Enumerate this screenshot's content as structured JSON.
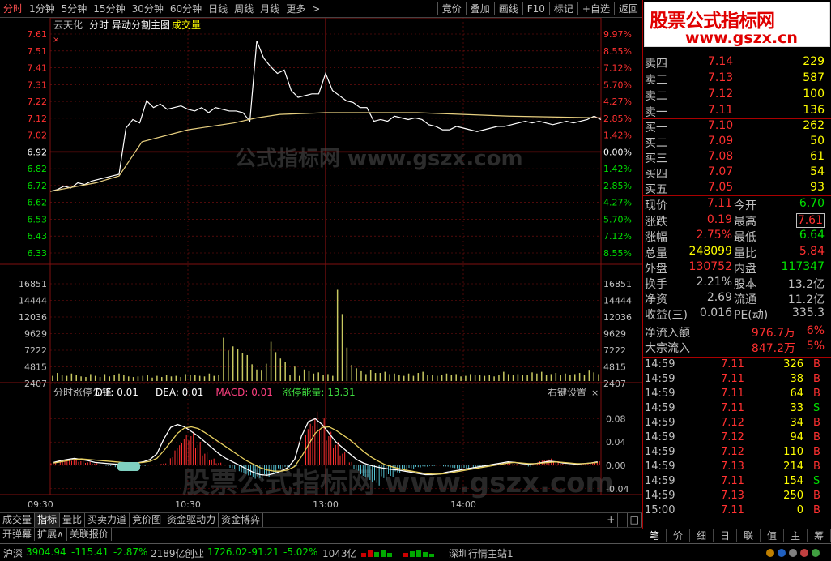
{
  "toolbar": {
    "periods": [
      "分时",
      "1分钟",
      "5分钟",
      "15分钟",
      "30分钟",
      "60分钟",
      "日线",
      "周线",
      "月线",
      "更多"
    ],
    "more_arrow": ">",
    "right_buttons": [
      "竞价",
      "叠加",
      "画线",
      "F10",
      "标记",
      "+自选",
      "返回"
    ]
  },
  "chart_header": {
    "stock": "云天化",
    "mode": "分时",
    "overlay": "异动分割主图",
    "volume_label": "成交量",
    "close_mark": "×"
  },
  "indicator_header": {
    "name": "分时涨停先锋",
    "dif": "DIF: 0.01",
    "dea": "DEA: 0.01",
    "macd": "MACD: 0.01",
    "energy": "涨停能量: 13.31",
    "settings": "右键设置",
    "close": "×"
  },
  "watermark_left": "公式指标网 www.gszx.com",
  "watermark_right": "股票公式指标网 www.gszx.com",
  "colors": {
    "up": "#ff3030",
    "down": "#00e000",
    "flat": "#c0c0c0",
    "price_line": "#ffffff",
    "avg_line": "#e8d080",
    "volume": "#c8c860",
    "grid": "#801010",
    "yellow": "#ffff00",
    "macd_pos": "#ff3030",
    "macd_neg": "#54c0d0"
  },
  "chart_data": [
    {
      "type": "line",
      "title": "分时",
      "y_left_ticks": [
        "7.61",
        "7.51",
        "7.41",
        "7.31",
        "7.22",
        "7.12",
        "7.02",
        "6.92",
        "6.82",
        "6.72",
        "6.62",
        "6.53",
        "6.43",
        "6.33"
      ],
      "y_right_ticks": [
        "9.97%",
        "8.55%",
        "7.12%",
        "5.70%",
        "4.27%",
        "2.85%",
        "1.42%",
        "0.00%",
        "1.42%",
        "2.85%",
        "4.27%",
        "5.70%",
        "7.12%",
        "8.55%"
      ],
      "x_ticks": [
        "09:30",
        "10:30",
        "13:00",
        "14:00"
      ],
      "ylim": [
        6.33,
        7.61
      ],
      "prev_close": 6.92,
      "series": [
        {
          "name": "价格",
          "x": [
            0,
            3,
            6,
            9,
            12,
            15,
            18,
            21,
            24,
            27,
            30,
            33,
            36,
            39,
            42,
            45,
            48,
            51,
            54,
            57,
            60,
            63,
            66,
            69,
            72,
            75,
            78,
            81,
            84,
            87,
            90,
            93,
            96,
            99,
            102,
            105,
            108,
            111,
            114,
            117,
            120,
            123,
            126,
            129,
            132,
            135,
            138,
            141,
            144,
            147,
            150,
            153,
            156,
            159,
            162,
            165,
            168,
            171,
            174,
            177,
            180,
            183,
            186,
            189,
            192,
            195,
            198,
            201,
            204,
            207,
            210,
            213,
            216,
            219,
            222,
            225,
            228,
            231,
            234,
            237,
            240
          ],
          "values": [
            6.69,
            6.7,
            6.72,
            6.71,
            6.74,
            6.73,
            6.75,
            6.76,
            6.77,
            6.78,
            6.79,
            7.06,
            7.11,
            7.09,
            7.22,
            7.18,
            7.2,
            7.17,
            7.18,
            7.19,
            7.17,
            7.16,
            7.18,
            7.15,
            7.18,
            7.17,
            7.16,
            7.16,
            7.15,
            7.1,
            7.57,
            7.47,
            7.42,
            7.38,
            7.4,
            7.28,
            7.24,
            7.25,
            7.26,
            7.26,
            7.38,
            7.28,
            7.25,
            7.22,
            7.21,
            7.18,
            7.18,
            7.1,
            7.11,
            7.1,
            7.13,
            7.12,
            7.11,
            7.12,
            7.11,
            7.08,
            7.07,
            7.05,
            7.05,
            7.07,
            7.06,
            7.05,
            7.04,
            7.05,
            7.06,
            7.07,
            7.07,
            7.08,
            7.09,
            7.1,
            7.09,
            7.1,
            7.09,
            7.08,
            7.09,
            7.1,
            7.09,
            7.1,
            7.11,
            7.13,
            7.11
          ]
        },
        {
          "name": "均价",
          "x": [
            0,
            20,
            30,
            40,
            60,
            80,
            90,
            100,
            120,
            160,
            200,
            240
          ],
          "values": [
            6.69,
            6.74,
            6.78,
            6.98,
            7.05,
            7.09,
            7.12,
            7.14,
            7.15,
            7.15,
            7.13,
            7.12
          ]
        }
      ]
    },
    {
      "type": "bar",
      "title": "成交量",
      "y_ticks": [
        "16851",
        "14444",
        "12036",
        "9629",
        "7222",
        "4815",
        "2407"
      ],
      "ylim": [
        0,
        16851
      ],
      "volumes_by_bucket": [
        900,
        1400,
        1100,
        900,
        1300,
        1000,
        800,
        700,
        1200,
        900,
        700,
        1200,
        800,
        1000,
        1300,
        1100,
        800,
        700,
        800,
        900,
        1000,
        600,
        900,
        700,
        1000,
        800,
        900,
        700,
        1200,
        1100,
        1000,
        900,
        800,
        1300,
        900,
        1000,
        7500,
        5300,
        6000,
        5600,
        4800,
        4500,
        2900,
        2000,
        1800,
        3000,
        6800,
        5000,
        3900,
        3300,
        1100,
        2500,
        900,
        2000,
        1700,
        1300,
        1500,
        1100,
        1200,
        900,
        15800,
        11600,
        5800,
        2800,
        2200,
        1700,
        1200,
        1900,
        1400,
        1400,
        1600,
        1200,
        1300,
        1100,
        900,
        1300,
        900,
        1400,
        1600,
        1100,
        1000,
        900,
        1100,
        1300,
        1000,
        1200,
        800,
        900,
        1200,
        1000,
        1100,
        900,
        1000,
        800,
        1100,
        1600,
        1200,
        1000,
        1200,
        1000,
        1100,
        1500,
        1300,
        1600,
        1100,
        1200,
        1400,
        1100,
        1300,
        1100,
        1200,
        1400,
        1000,
        1800,
        1500,
        1200
      ]
    },
    {
      "type": "bar",
      "title": "分时涨停先锋",
      "y_ticks": [
        "0.08",
        "0.04",
        "0.00",
        "-0.04"
      ],
      "ylim": [
        -0.05,
        0.1
      ],
      "macd": [
        0.004,
        0.006,
        0.008,
        0.009,
        0.007,
        0.005,
        0.003,
        0.001,
        -0.001,
        -0.003,
        -0.004,
        -0.003,
        -0.002,
        -0.001,
        0.0,
        0.001,
        0.003,
        0.012,
        0.03,
        0.045,
        0.05,
        0.035,
        0.02,
        0.01,
        0.004,
        0.0,
        -0.005,
        -0.01,
        -0.015,
        -0.02,
        -0.022,
        -0.018,
        -0.012,
        -0.006,
        -0.003,
        -0.001,
        0.0,
        0.062,
        0.08,
        0.07,
        0.05,
        0.035,
        0.02,
        0.005,
        -0.008,
        -0.018,
        -0.025,
        -0.03,
        -0.022,
        -0.018,
        -0.012,
        -0.008,
        -0.005,
        -0.003,
        -0.002,
        -0.001,
        0.0,
        -0.002,
        -0.004,
        -0.006,
        -0.005,
        -0.004,
        -0.003,
        -0.002,
        0.002,
        0.004,
        0.003,
        0.002,
        0.0,
        -0.002,
        0.004,
        0.008,
        0.01,
        0.006,
        0.003,
        0.001,
        0.0,
        0.002,
        0.004,
        0.006
      ],
      "dif": [
        0.005,
        0.008,
        0.01,
        0.012,
        0.01,
        0.008,
        0.005,
        0.004,
        0.003,
        0.002,
        0.002,
        0.003,
        0.004,
        0.006,
        0.01,
        0.02,
        0.045,
        0.065,
        0.07,
        0.066,
        0.058,
        0.05,
        0.04,
        0.03,
        0.02,
        0.012,
        0.006,
        0.0,
        -0.006,
        -0.012,
        -0.016,
        -0.017,
        -0.014,
        -0.01,
        -0.004,
        0.01,
        0.05,
        0.075,
        0.08,
        0.07,
        0.055,
        0.04,
        0.03,
        0.02,
        0.01,
        0.004,
        0.0,
        -0.003,
        -0.005,
        -0.007,
        -0.008,
        -0.01,
        -0.012,
        -0.014,
        -0.016,
        -0.016,
        -0.015,
        -0.012,
        -0.01,
        -0.008,
        -0.006,
        -0.004,
        -0.002,
        0.0,
        0.002,
        0.004,
        0.006,
        0.005,
        0.003,
        0.002,
        0.003,
        0.005,
        0.007,
        0.006,
        0.004,
        0.003,
        0.002,
        0.003,
        0.004,
        0.006
      ],
      "dea": [
        0.004,
        0.006,
        0.008,
        0.01,
        0.011,
        0.01,
        0.009,
        0.008,
        0.007,
        0.006,
        0.005,
        0.004,
        0.004,
        0.005,
        0.007,
        0.012,
        0.025,
        0.04,
        0.055,
        0.064,
        0.066,
        0.063,
        0.056,
        0.048,
        0.04,
        0.032,
        0.024,
        0.016,
        0.008,
        0.002,
        -0.004,
        -0.008,
        -0.01,
        -0.01,
        -0.008,
        -0.002,
        0.015,
        0.035,
        0.055,
        0.065,
        0.066,
        0.06,
        0.052,
        0.044,
        0.034,
        0.024,
        0.015,
        0.008,
        0.002,
        -0.002,
        -0.005,
        -0.008,
        -0.01,
        -0.012,
        -0.014,
        -0.015,
        -0.015,
        -0.014,
        -0.012,
        -0.01,
        -0.008,
        -0.006,
        -0.004,
        -0.002,
        0.0,
        0.002,
        0.004,
        0.005,
        0.004,
        0.003,
        0.003,
        0.004,
        0.005,
        0.006,
        0.005,
        0.004,
        0.003,
        0.003,
        0.004,
        0.005
      ]
    }
  ],
  "orderbook": {
    "sell": [
      {
        "label": "卖五",
        "price": "",
        "vol": ""
      },
      {
        "label": "卖四",
        "price": "7.14",
        "vol": "229"
      },
      {
        "label": "卖三",
        "price": "7.13",
        "vol": "587"
      },
      {
        "label": "卖二",
        "price": "7.12",
        "vol": "100"
      },
      {
        "label": "卖一",
        "price": "7.11",
        "vol": "136"
      }
    ],
    "buy": [
      {
        "label": "买一",
        "price": "7.10",
        "vol": "262"
      },
      {
        "label": "买二",
        "price": "7.09",
        "vol": "50"
      },
      {
        "label": "买三",
        "price": "7.08",
        "vol": "61"
      },
      {
        "label": "买四",
        "price": "7.07",
        "vol": "54"
      },
      {
        "label": "买五",
        "price": "7.05",
        "vol": "93"
      }
    ]
  },
  "quote": {
    "rows": [
      {
        "l1": "现价",
        "v1": "7.11",
        "c1": "up",
        "l2": "今开",
        "v2": "6.70",
        "c2": "down"
      },
      {
        "l1": "涨跌",
        "v1": "0.19",
        "c1": "up",
        "l2": "最高",
        "v2": "7.61",
        "c2": "up",
        "box2": true
      },
      {
        "l1": "涨幅",
        "v1": "2.75%",
        "c1": "up",
        "l2": "最低",
        "v2": "6.64",
        "c2": "down"
      },
      {
        "l1": "总量",
        "v1": "248099",
        "c1": "yellow",
        "l2": "量比",
        "v2": "5.84",
        "c2": "up"
      },
      {
        "l1": "外盘",
        "v1": "130752",
        "c1": "up",
        "l2": "内盘",
        "v2": "117347",
        "c2": "down"
      }
    ],
    "rows2": [
      {
        "l1": "换手",
        "v1": "2.21%",
        "l2": "股本",
        "v2": "13.2亿"
      },
      {
        "l1": "净资",
        "v1": "2.69",
        "l2": "流通",
        "v2": "11.2亿"
      },
      {
        "l1": "收益(三)",
        "v1": "0.016",
        "l2": "PE(动)",
        "v2": "335.3"
      }
    ],
    "flow": [
      {
        "label": "净流入额",
        "value": "976.7万",
        "pct": "6%"
      },
      {
        "label": "大宗流入",
        "value": "847.2万",
        "pct": "5%"
      }
    ]
  },
  "ticks": [
    {
      "t": "14:59",
      "p": "7.11",
      "v": "326",
      "s": "B"
    },
    {
      "t": "14:59",
      "p": "7.11",
      "v": "38",
      "s": "B"
    },
    {
      "t": "14:59",
      "p": "7.11",
      "v": "64",
      "s": "B"
    },
    {
      "t": "14:59",
      "p": "7.11",
      "v": "33",
      "s": "S"
    },
    {
      "t": "14:59",
      "p": "7.12",
      "v": "34",
      "s": "B"
    },
    {
      "t": "14:59",
      "p": "7.12",
      "v": "94",
      "s": "B"
    },
    {
      "t": "14:59",
      "p": "7.12",
      "v": "110",
      "s": "B"
    },
    {
      "t": "14:59",
      "p": "7.13",
      "v": "214",
      "s": "B"
    },
    {
      "t": "14:59",
      "p": "7.11",
      "v": "154",
      "s": "S"
    },
    {
      "t": "14:59",
      "p": "7.13",
      "v": "250",
      "s": "B"
    },
    {
      "t": "15:00",
      "p": "7.11",
      "v": "0",
      "s": "B"
    }
  ],
  "side_tabs": [
    "笔",
    "价",
    "细",
    "日",
    "联",
    "值",
    "主",
    "筹"
  ],
  "logo": {
    "line1": "股票公式指标网",
    "line2": "www.gszx.cn"
  },
  "bottom_tabs": [
    "成交量",
    "指标",
    "量比",
    "买卖力道",
    "竞价图",
    "资金驱动力",
    "资金博弈"
  ],
  "bottom_tabs_active": 1,
  "bottom_controls": [
    "+",
    "-",
    "□"
  ],
  "tabs2": [
    "开弹幕",
    "扩展∧",
    "关联报价"
  ],
  "status": {
    "sh_label": "沪深",
    "sh_val": "3904.94",
    "sh_chg": "-115.41",
    "sh_pct": "-2.87%",
    "sh_amt": "2189亿",
    "cy_label": "创业",
    "cy_val": "1726.02",
    "cy_chg": "-91.21",
    "cy_pct": "-5.02%",
    "cy_amt": "1043亿",
    "server": "深圳行情主站1"
  }
}
